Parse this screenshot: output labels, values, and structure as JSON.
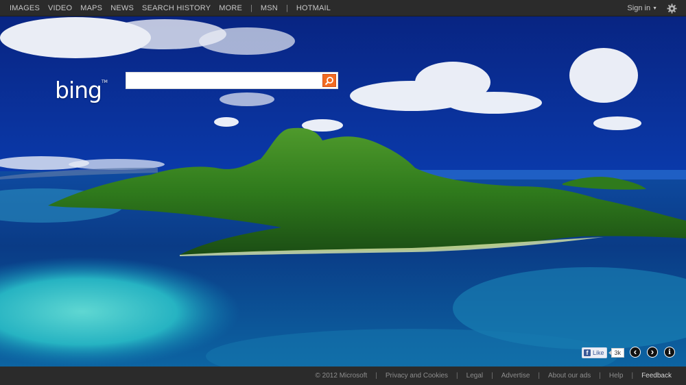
{
  "topnav": {
    "items": [
      "IMAGES",
      "VIDEO",
      "MAPS",
      "NEWS",
      "SEARCH HISTORY",
      "MORE"
    ],
    "separator": "|",
    "extra": [
      "MSN",
      "HOTMAIL"
    ]
  },
  "account": {
    "signin_label": "Sign in",
    "caret": "▼"
  },
  "settings": {
    "icon": "gear-icon"
  },
  "logo": {
    "text": "bing",
    "mark": "TM"
  },
  "search": {
    "value": "",
    "placeholder": "",
    "button_icon": "search-icon"
  },
  "social": {
    "like_label": "Like",
    "fb_glyph": "f",
    "like_count": "3k"
  },
  "controls": {
    "prev_icon": "chevron-left-icon",
    "prev_glyph": "‹",
    "next_icon": "chevron-right-icon",
    "next_glyph": "›",
    "info_icon": "info-icon",
    "info_glyph": "i"
  },
  "footer": {
    "copyright": "© 2012 Microsoft",
    "separator": "|",
    "links": [
      "Privacy and Cookies",
      "Legal",
      "Advertise",
      "About our ads",
      "Help"
    ],
    "feedback": "Feedback"
  },
  "colors": {
    "accent": "#f26b21",
    "bar": "#2b2b2b",
    "sky": "#0b3ca8",
    "ocean": "#0f5fa0"
  }
}
